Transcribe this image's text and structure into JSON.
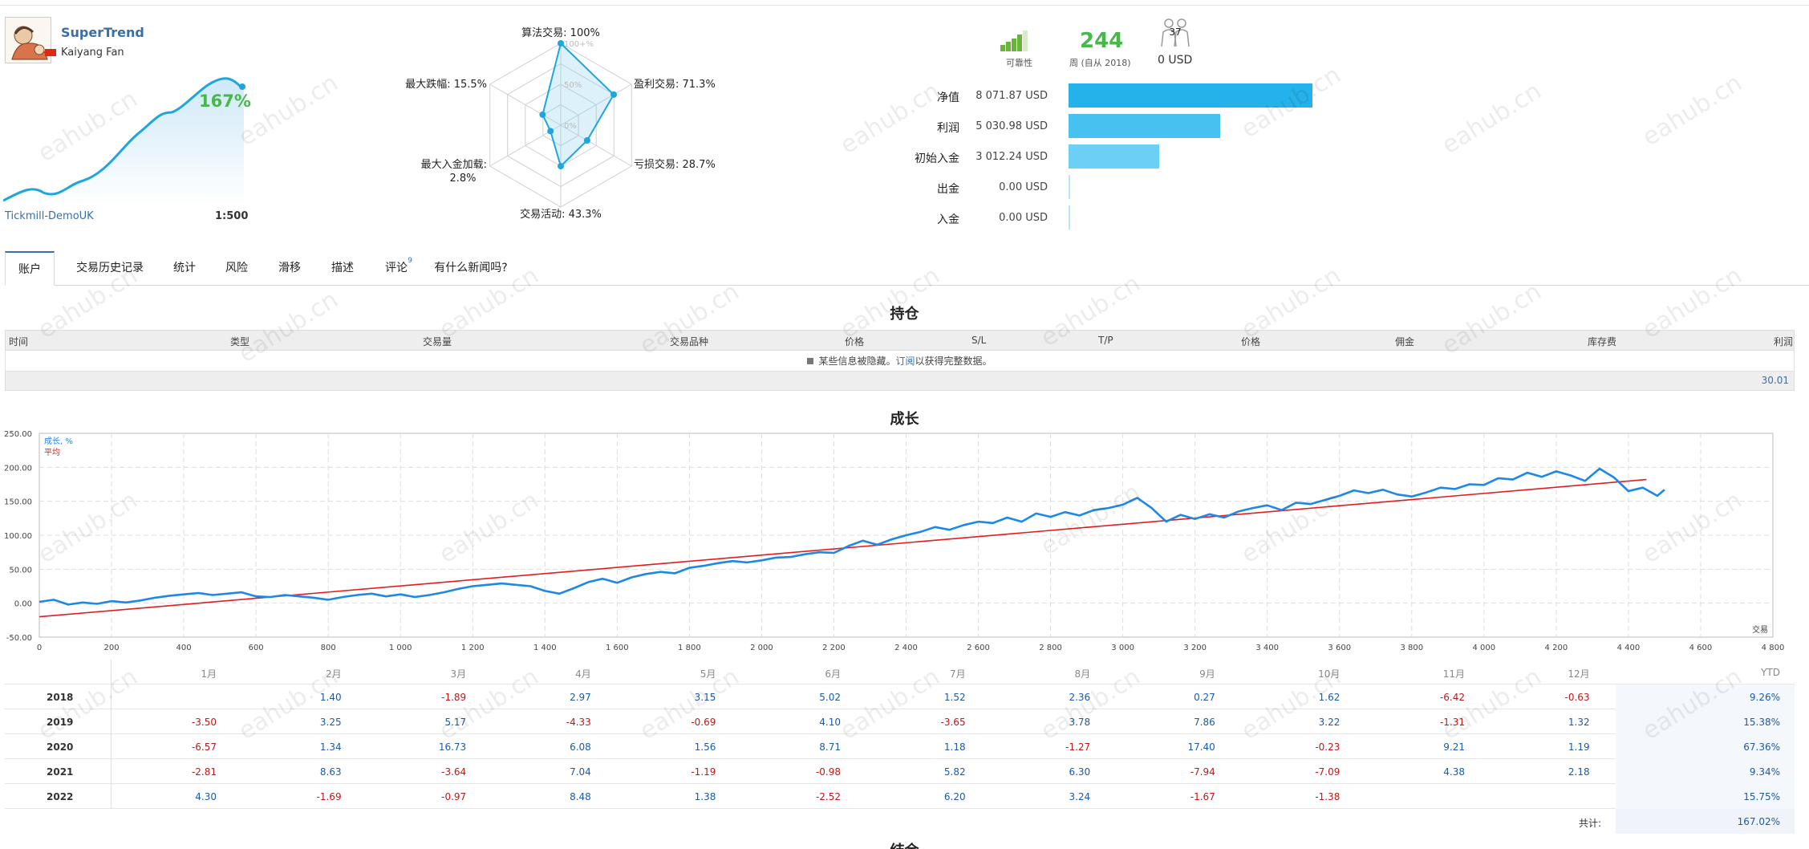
{
  "signal": {
    "name": "SuperTrend",
    "author": "Kaiyang Fan",
    "growth_pct": "167%",
    "broker": "Tickmill-DemoUK",
    "leverage": "1:500"
  },
  "radar": {
    "labels": {
      "algo": "算法交易: 100%",
      "profit": "盈利交易: 71.3%",
      "loss": "亏损交易: 28.7%",
      "activity": "交易活动: 43.3%",
      "load_line1": "最大入金加载:",
      "load_line2": "2.8%",
      "drawdown": "最大跌幅: 15.5%"
    },
    "rings": [
      "100+%",
      "50%",
      "0%"
    ],
    "values": {
      "algo": 100,
      "profit": 71.3,
      "loss": 28.7,
      "activity": 43.3,
      "load": 2.8,
      "drawdown": 15.5
    }
  },
  "stats": {
    "reliability_label": "可靠性",
    "weeks": "244",
    "weeks_label": "周 (自从 2018)",
    "subscribers": "37",
    "subscription": "0 USD",
    "bars": [
      {
        "label": "净值",
        "value": "8 071.87 USD",
        "amount": 8071.87,
        "color": "#25b2ea"
      },
      {
        "label": "利润",
        "value": "5 030.98 USD",
        "amount": 5030.98,
        "color": "#47c1f0"
      },
      {
        "label": "初始入金",
        "value": "3 012.24 USD",
        "amount": 3012.24,
        "color": "#6ccff6"
      },
      {
        "label": "出金",
        "value": "0.00 USD",
        "amount": 0,
        "color": "#6ccff6"
      },
      {
        "label": "入金",
        "value": "0.00 USD",
        "amount": 0,
        "color": "#6ccff6"
      }
    ]
  },
  "tabs": [
    {
      "label": "账户",
      "active": true
    },
    {
      "label": "交易历史记录"
    },
    {
      "label": "统计"
    },
    {
      "label": "风险"
    },
    {
      "label": "滑移"
    },
    {
      "label": "描述"
    },
    {
      "label": "评论",
      "badge": "9"
    },
    {
      "label": "有什么新闻吗?"
    }
  ],
  "positions": {
    "title": "持仓",
    "columns": [
      "时间",
      "类型",
      "交易量",
      "交易品种",
      "价格",
      "S/L",
      "T/P",
      "价格",
      "佣金",
      "库存费",
      "利润"
    ],
    "hidden_prefix": "某些信息被隐藏。",
    "hidden_link": "订阅",
    "hidden_suffix": "以获得完整数据。",
    "total": "30.01"
  },
  "growth": {
    "title": "成长",
    "legend_growth": "成长, %",
    "legend_avg": "平均",
    "x_axis_label": "交易",
    "growth_color": "#1e88e5",
    "avg_color": "#e01e1e",
    "y_ticks": [
      "250.00",
      "200.00",
      "150.00",
      "100.00",
      "50.00",
      "0.00",
      "-50.00"
    ],
    "x_ticks": [
      "0",
      "200",
      "400",
      "600",
      "800",
      "1 000",
      "1 200",
      "1 400",
      "1 600",
      "1 800",
      "2 000",
      "2 200",
      "2 400",
      "2 600",
      "2 800",
      "3 000",
      "3 200",
      "3 400",
      "3 600",
      "3 800",
      "4 000",
      "4 200",
      "4 400",
      "4 600",
      "4 800"
    ],
    "avg_line": [
      [
        0,
        -20
      ],
      [
        4450,
        182
      ]
    ],
    "series": [
      [
        0,
        2
      ],
      [
        40,
        5
      ],
      [
        80,
        -2
      ],
      [
        120,
        1
      ],
      [
        160,
        -1
      ],
      [
        200,
        3
      ],
      [
        240,
        1
      ],
      [
        280,
        4
      ],
      [
        320,
        8
      ],
      [
        360,
        11
      ],
      [
        400,
        13
      ],
      [
        440,
        15
      ],
      [
        480,
        12
      ],
      [
        520,
        14
      ],
      [
        560,
        16
      ],
      [
        600,
        10
      ],
      [
        640,
        9
      ],
      [
        680,
        12
      ],
      [
        720,
        10
      ],
      [
        760,
        8
      ],
      [
        800,
        5
      ],
      [
        840,
        9
      ],
      [
        880,
        12
      ],
      [
        920,
        14
      ],
      [
        960,
        10
      ],
      [
        1000,
        13
      ],
      [
        1040,
        9
      ],
      [
        1080,
        12
      ],
      [
        1120,
        16
      ],
      [
        1160,
        21
      ],
      [
        1200,
        25
      ],
      [
        1240,
        27
      ],
      [
        1280,
        29
      ],
      [
        1320,
        27
      ],
      [
        1360,
        25
      ],
      [
        1400,
        18
      ],
      [
        1440,
        14
      ],
      [
        1480,
        22
      ],
      [
        1520,
        31
      ],
      [
        1560,
        36
      ],
      [
        1600,
        30
      ],
      [
        1640,
        38
      ],
      [
        1680,
        43
      ],
      [
        1720,
        46
      ],
      [
        1760,
        44
      ],
      [
        1800,
        52
      ],
      [
        1840,
        55
      ],
      [
        1880,
        59
      ],
      [
        1920,
        62
      ],
      [
        1960,
        60
      ],
      [
        2000,
        63
      ],
      [
        2040,
        67
      ],
      [
        2080,
        68
      ],
      [
        2120,
        72
      ],
      [
        2160,
        75
      ],
      [
        2200,
        74
      ],
      [
        2240,
        84
      ],
      [
        2280,
        92
      ],
      [
        2320,
        86
      ],
      [
        2360,
        94
      ],
      [
        2400,
        100
      ],
      [
        2440,
        105
      ],
      [
        2480,
        112
      ],
      [
        2520,
        108
      ],
      [
        2560,
        115
      ],
      [
        2600,
        120
      ],
      [
        2640,
        118
      ],
      [
        2680,
        126
      ],
      [
        2720,
        120
      ],
      [
        2760,
        132
      ],
      [
        2800,
        127
      ],
      [
        2840,
        134
      ],
      [
        2880,
        129
      ],
      [
        2920,
        137
      ],
      [
        2960,
        140
      ],
      [
        3000,
        145
      ],
      [
        3040,
        155
      ],
      [
        3080,
        140
      ],
      [
        3120,
        120
      ],
      [
        3160,
        130
      ],
      [
        3200,
        124
      ],
      [
        3240,
        131
      ],
      [
        3280,
        126
      ],
      [
        3320,
        135
      ],
      [
        3360,
        140
      ],
      [
        3400,
        144
      ],
      [
        3440,
        137
      ],
      [
        3480,
        148
      ],
      [
        3520,
        146
      ],
      [
        3560,
        152
      ],
      [
        3600,
        158
      ],
      [
        3640,
        166
      ],
      [
        3680,
        162
      ],
      [
        3720,
        167
      ],
      [
        3760,
        160
      ],
      [
        3800,
        157
      ],
      [
        3840,
        163
      ],
      [
        3880,
        170
      ],
      [
        3920,
        168
      ],
      [
        3960,
        175
      ],
      [
        4000,
        174
      ],
      [
        4040,
        184
      ],
      [
        4080,
        182
      ],
      [
        4120,
        192
      ],
      [
        4160,
        186
      ],
      [
        4200,
        194
      ],
      [
        4240,
        188
      ],
      [
        4280,
        180
      ],
      [
        4320,
        198
      ],
      [
        4360,
        185
      ],
      [
        4400,
        165
      ],
      [
        4440,
        170
      ],
      [
        4480,
        158
      ],
      [
        4500,
        167
      ]
    ],
    "chart_data": {
      "type": "line",
      "xlabel": "交易",
      "ylim": [
        -50,
        250
      ],
      "xlim": [
        0,
        4800
      ]
    }
  },
  "monthly": {
    "months": [
      "1月",
      "2月",
      "3月",
      "4月",
      "5月",
      "6月",
      "7月",
      "8月",
      "9月",
      "10月",
      "11月",
      "12月"
    ],
    "ytd_label": "YTD",
    "rows": [
      {
        "year": "2018",
        "values": [
          "",
          "1.40",
          "-1.89",
          "2.97",
          "3.15",
          "5.02",
          "1.52",
          "2.36",
          "0.27",
          "1.62",
          "-6.42",
          "-0.63"
        ],
        "ytd": "9.26%"
      },
      {
        "year": "2019",
        "values": [
          "-3.50",
          "3.25",
          "5.17",
          "-4.33",
          "-0.69",
          "4.10",
          "-3.65",
          "3.78",
          "7.86",
          "3.22",
          "-1.31",
          "1.32"
        ],
        "ytd": "15.38%"
      },
      {
        "year": "2020",
        "values": [
          "-6.57",
          "1.34",
          "16.73",
          "6.08",
          "1.56",
          "8.71",
          "1.18",
          "-1.27",
          "17.40",
          "-0.23",
          "9.21",
          "1.19"
        ],
        "ytd": "67.36%"
      },
      {
        "year": "2021",
        "values": [
          "-2.81",
          "8.63",
          "-3.64",
          "7.04",
          "-1.19",
          "-0.98",
          "5.82",
          "6.30",
          "-7.94",
          "-7.09",
          "4.38",
          "2.18"
        ],
        "ytd": "9.34%"
      },
      {
        "year": "2022",
        "values": [
          "4.30",
          "-1.69",
          "-0.97",
          "8.48",
          "1.38",
          "-2.52",
          "6.20",
          "3.24",
          "-1.67",
          "-1.38",
          "",
          ""
        ],
        "ytd": "15.75%"
      }
    ],
    "total_label": "共计:",
    "total_value": "167.02%"
  },
  "next_section_title": "结余",
  "watermark": "eahub.cn"
}
